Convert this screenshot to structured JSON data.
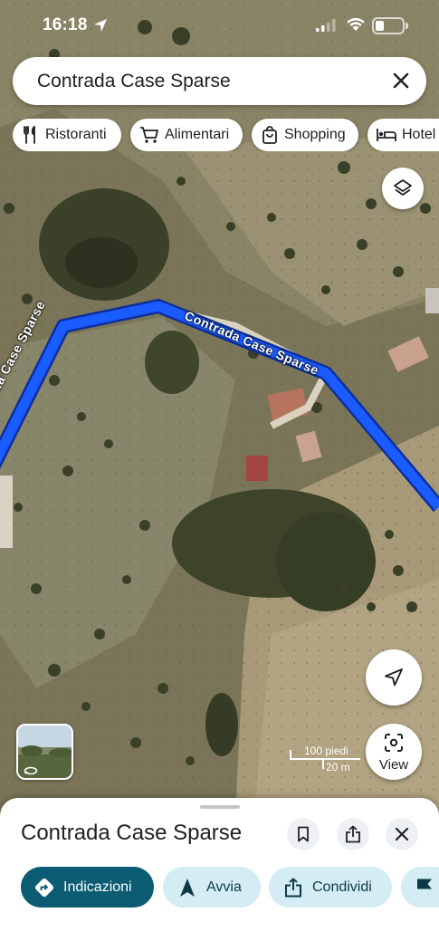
{
  "status_bar": {
    "time": "16:18"
  },
  "search": {
    "query": "Contrada Case Sparse"
  },
  "chips": [
    {
      "label": "Ristoranti",
      "icon": "fork-knife-icon"
    },
    {
      "label": "Alimentari",
      "icon": "cart-icon"
    },
    {
      "label": "Shopping",
      "icon": "shopping-bag-icon"
    },
    {
      "label": "Hotel",
      "icon": "bed-icon"
    }
  ],
  "map": {
    "road_label": "Contrada Case Sparse",
    "route_color": "#1a5cff",
    "scale": {
      "imperial": "100 piedi",
      "metric": "20 m"
    }
  },
  "view_button": {
    "label": "View"
  },
  "place": {
    "title": "Contrada Case Sparse"
  },
  "actions": [
    {
      "label": "Indicazioni",
      "icon": "directions-icon",
      "style": "primary"
    },
    {
      "label": "Avvia",
      "icon": "navigation-arrow-icon",
      "style": "secondary"
    },
    {
      "label": "Condividi",
      "icon": "share-icon",
      "style": "secondary"
    },
    {
      "label": "",
      "icon": "flag-icon",
      "style": "secondary"
    }
  ],
  "colors": {
    "primary": "#0b5b72",
    "secondary_bg": "#d4ecf3",
    "route": "#1a5cff"
  }
}
